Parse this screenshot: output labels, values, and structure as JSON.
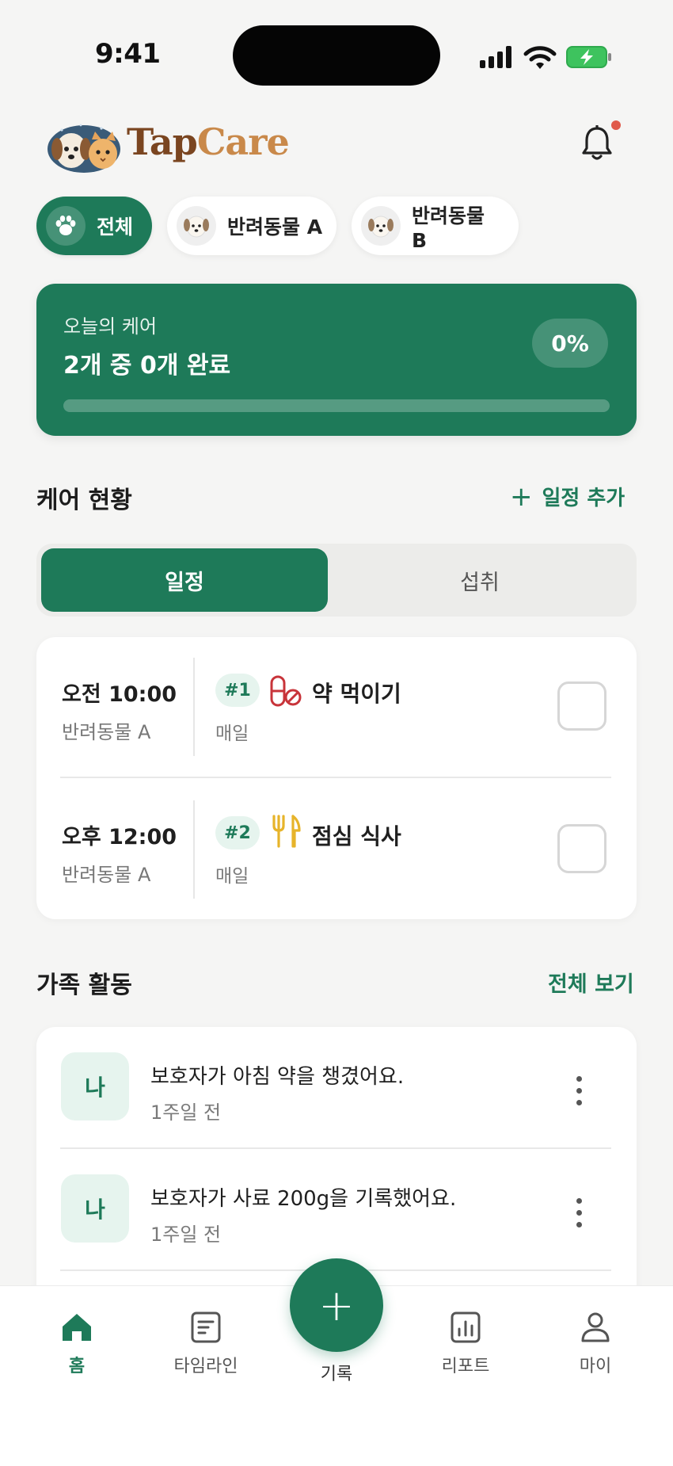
{
  "status_bar": {
    "time": "9:41"
  },
  "header": {
    "brand_part1": "Tap",
    "brand_part2": "Care",
    "notification_dot": true
  },
  "pet_filters": [
    {
      "label": "전체",
      "selected": true
    },
    {
      "label": "반려동물 A",
      "selected": false
    },
    {
      "label": "반려동물 B",
      "selected": false
    }
  ],
  "today_card": {
    "label": "오늘의 케어",
    "summary": "2개 중 0개 완료",
    "percent_label": "0%",
    "progress": 0
  },
  "care_section": {
    "title": "케어 현황",
    "add_label": "일정 추가",
    "tabs": [
      {
        "label": "일정",
        "active": true
      },
      {
        "label": "섭취",
        "active": false
      }
    ],
    "items": [
      {
        "time": "오전 10:00",
        "pet": "반려동물 A",
        "badge": "#1",
        "icon": "pill-icon",
        "name": "약 먹이기",
        "frequency": "매일",
        "done": false
      },
      {
        "time": "오후 12:00",
        "pet": "반려동물 A",
        "badge": "#2",
        "icon": "fork-knife-icon",
        "name": "점심 식사",
        "frequency": "매일",
        "done": false
      }
    ]
  },
  "family_section": {
    "title": "가족 활동",
    "view_all": "전체 보기",
    "items": [
      {
        "avatar": "나",
        "text": "보호자가 아침 약을 챙겼어요.",
        "time": "1주일 전"
      },
      {
        "avatar": "나",
        "text": "보호자가 사료 200g을 기록했어요.",
        "time": "1주일 전"
      }
    ]
  },
  "bottom_nav": {
    "items": [
      {
        "label": "홈",
        "icon": "home-icon",
        "active": true
      },
      {
        "label": "타임라인",
        "icon": "timeline-icon",
        "active": false
      },
      {
        "label": "기록",
        "icon": "plus-icon",
        "active": false
      },
      {
        "label": "리포트",
        "icon": "report-icon",
        "active": false
      },
      {
        "label": "마이",
        "icon": "person-icon",
        "active": false
      }
    ]
  },
  "colors": {
    "primary": "#1e7a59",
    "brand_dark": "#7a4520",
    "brand_light": "#c9894a",
    "notification": "#e05a4a",
    "pill": "#c8343a",
    "fork": "#e7b42a"
  }
}
